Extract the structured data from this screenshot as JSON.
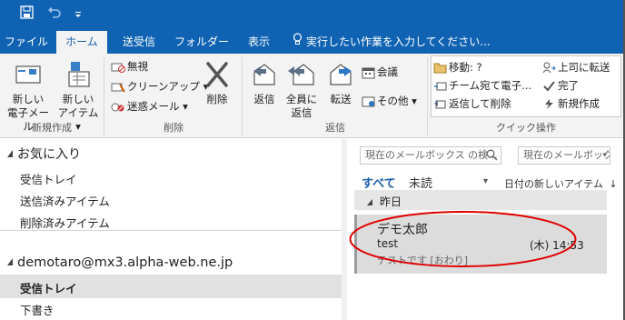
{
  "quick_access": {
    "save_icon": "save-icon",
    "undo_icon": "undo-icon",
    "customize_icon": "chevron-down-icon"
  },
  "tabs": [
    {
      "label": "ファイル"
    },
    {
      "label": "ホーム",
      "active": true
    },
    {
      "label": "送受信"
    },
    {
      "label": "フォルダー"
    },
    {
      "label": "表示"
    }
  ],
  "tell_me": {
    "icon": "lightbulb-icon",
    "placeholder": "実行したい作業を入力してください..."
  },
  "ribbon": {
    "new_group": {
      "label": "新規作成",
      "new_mail": {
        "line1": "新しい",
        "line2": "電子メール"
      },
      "new_items": {
        "line1": "新しい",
        "line2": "アイテム ▾"
      }
    },
    "delete_group": {
      "label": "削除",
      "ignore": "無視",
      "cleanup": "クリーンアップ ▾",
      "junk": "迷惑メール ▾",
      "delete": "削除"
    },
    "respond_group": {
      "label": "返信",
      "reply": "返信",
      "reply_all": {
        "line1": "全員に",
        "line2": "返信"
      },
      "forward": "転送",
      "meeting": "会議",
      "more": "その他 ▾"
    },
    "quick_steps": {
      "label": "クイック操作",
      "items": [
        "移動: ?",
        "チーム宛て電子...",
        "返信して削除",
        "上司に転送",
        "完了",
        "新規作成"
      ]
    }
  },
  "folder_pane": {
    "favorites_title": "お気に入り",
    "favorites": [
      "受信トレイ",
      "送信済みアイテム",
      "削除済みアイテム"
    ],
    "account": "demotaro@mx3.alpha-web.ne.jp",
    "account_folders": [
      "受信トレイ",
      "下書き"
    ]
  },
  "message_list": {
    "search_placeholder": "現在のメールボックス の検...",
    "scope": "現在のメールボックス",
    "filter_all": "すべて",
    "filter_unread": "未読",
    "sort": "日付の新しいアイテム",
    "date_group": "昨日",
    "message": {
      "sender": "デモ太郎",
      "subject": "test",
      "time": "(木) 14:53",
      "preview": "テストです [おわり]"
    }
  },
  "colors": {
    "title_bar": "#0f63b2",
    "ribbon_bg": "#f3f3f3",
    "accent_blue": "#1a5da8",
    "selected_item": "#dcdcdc",
    "highlight_circle": "#e00000"
  }
}
